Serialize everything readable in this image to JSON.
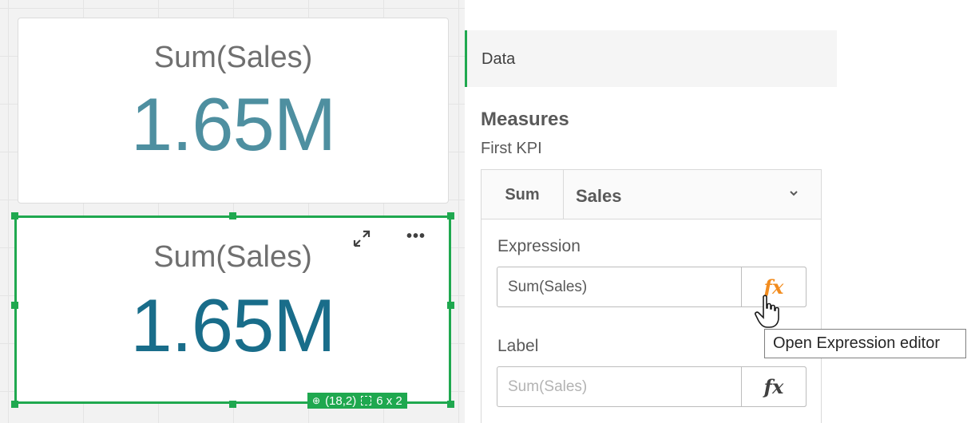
{
  "kpi_top": {
    "title": "Sum(Sales)",
    "value": "1.65M"
  },
  "kpi_bottom": {
    "title": "Sum(Sales)",
    "value": "1.65M",
    "position": "(18,2)",
    "size": "6 x 2"
  },
  "panel": {
    "data_label": "Data",
    "measures_title": "Measures",
    "measure_name": "First KPI",
    "aggregation": "Sum",
    "field": "Sales",
    "expression_label": "Expression",
    "expression_value": "Sum(Sales)",
    "label_label": "Label",
    "label_placeholder": "Sum(Sales)",
    "fx": "fx"
  },
  "tooltip": "Open Expression editor",
  "colors": {
    "accent": "#1fa84f",
    "kpi_top_value": "#4e8fa0",
    "kpi_bottom_value": "#196d8a",
    "fx_active": "#f28c1e"
  },
  "icons": {
    "expand": "expand-icon",
    "more": "more-icon",
    "chevron": "chevron-down-icon",
    "pin": "pin-icon",
    "grid": "grid-size-icon",
    "cursor": "hand-cursor-icon"
  }
}
